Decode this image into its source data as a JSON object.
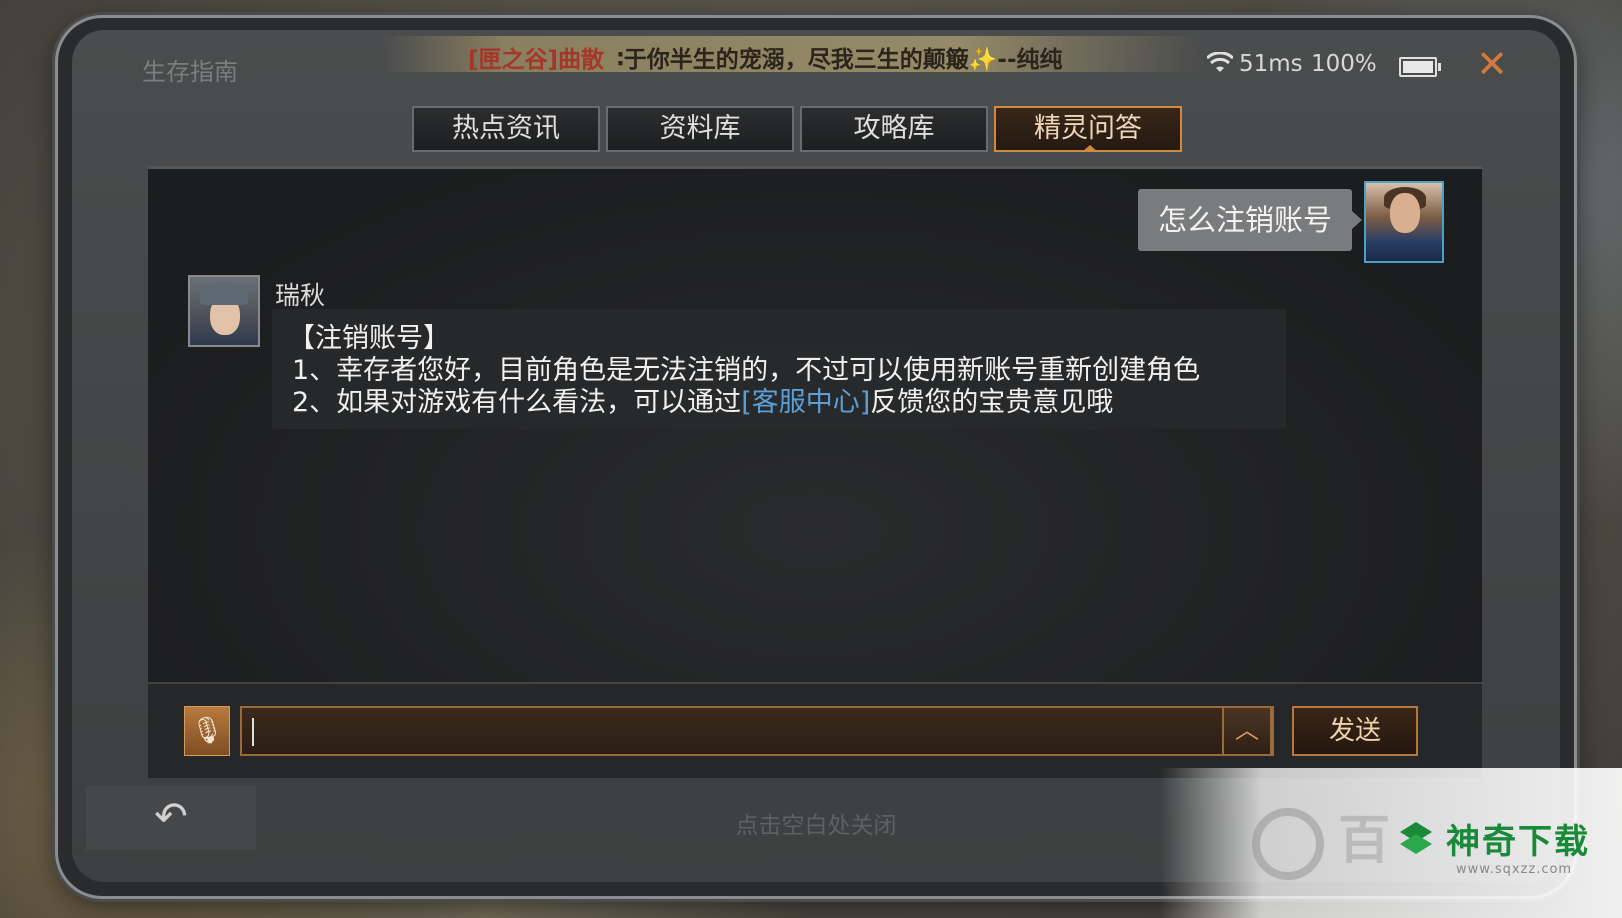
{
  "app": {
    "title": "生存指南",
    "close_icon": "close-icon"
  },
  "marquee": {
    "guild": "[匣之谷]曲散",
    "text": "∶于你半生的宠溺，尽我三生的颠簸✨--纯纯"
  },
  "status": {
    "ping": "51ms",
    "battery": "100%",
    "battery_level": 1.0
  },
  "tabs": [
    {
      "label": "热点资讯",
      "active": false
    },
    {
      "label": "资料库",
      "active": false
    },
    {
      "label": "攻略库",
      "active": false
    },
    {
      "label": "精灵问答",
      "active": true
    }
  ],
  "chat": {
    "user_message": "怎么注销账号",
    "bot_name": "瑞秋",
    "bot_reply": {
      "heading": "【注销账号】",
      "line1": "1、幸存者您好，目前角色是无法注销的，不过可以使用新账号重新创建角色",
      "line2_before": "2、如果对游戏有什么看法，可以通过",
      "line2_link": "[客服中心]",
      "line2_after": "反馈您的宝贵意见哦"
    }
  },
  "input": {
    "value": "",
    "send_label": "发送"
  },
  "footer": {
    "hint": "点击空白处关闭"
  },
  "watermark": {
    "faded_text": "百",
    "brand": "神奇下载",
    "url": "www.sqxzz.com"
  },
  "colors": {
    "accent": "#d08a3c",
    "link": "#5a9fd8",
    "brand_green": "#1a8a3a"
  }
}
